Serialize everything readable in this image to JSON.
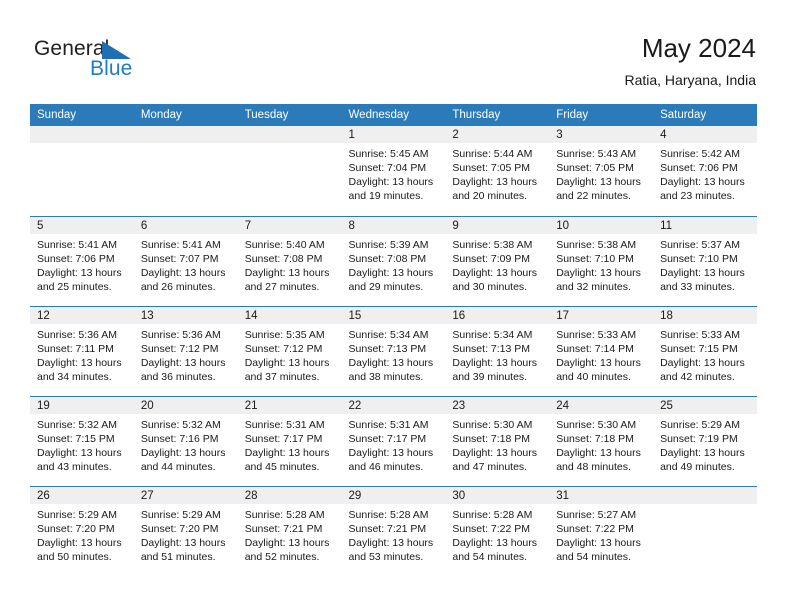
{
  "brand": {
    "name_part1": "General",
    "name_part2": "Blue",
    "flag_icon": "triangle-flag-icon",
    "accent_color": "#1f7ac7"
  },
  "header": {
    "month_title": "May 2024",
    "location": "Ratia, Haryana, India"
  },
  "colors": {
    "header_blue": "#2b7bba",
    "daynum_band": "#efefef",
    "text": "#1a1a1a"
  },
  "calendar": {
    "weekday_headers": [
      "Sunday",
      "Monday",
      "Tuesday",
      "Wednesday",
      "Thursday",
      "Friday",
      "Saturday"
    ],
    "weeks": [
      [
        {
          "day": "",
          "lines": []
        },
        {
          "day": "",
          "lines": []
        },
        {
          "day": "",
          "lines": []
        },
        {
          "day": "1",
          "lines": [
            "Sunrise: 5:45 AM",
            "Sunset: 7:04 PM",
            "Daylight: 13 hours",
            "and 19 minutes."
          ]
        },
        {
          "day": "2",
          "lines": [
            "Sunrise: 5:44 AM",
            "Sunset: 7:05 PM",
            "Daylight: 13 hours",
            "and 20 minutes."
          ]
        },
        {
          "day": "3",
          "lines": [
            "Sunrise: 5:43 AM",
            "Sunset: 7:05 PM",
            "Daylight: 13 hours",
            "and 22 minutes."
          ]
        },
        {
          "day": "4",
          "lines": [
            "Sunrise: 5:42 AM",
            "Sunset: 7:06 PM",
            "Daylight: 13 hours",
            "and 23 minutes."
          ]
        }
      ],
      [
        {
          "day": "5",
          "lines": [
            "Sunrise: 5:41 AM",
            "Sunset: 7:06 PM",
            "Daylight: 13 hours",
            "and 25 minutes."
          ]
        },
        {
          "day": "6",
          "lines": [
            "Sunrise: 5:41 AM",
            "Sunset: 7:07 PM",
            "Daylight: 13 hours",
            "and 26 minutes."
          ]
        },
        {
          "day": "7",
          "lines": [
            "Sunrise: 5:40 AM",
            "Sunset: 7:08 PM",
            "Daylight: 13 hours",
            "and 27 minutes."
          ]
        },
        {
          "day": "8",
          "lines": [
            "Sunrise: 5:39 AM",
            "Sunset: 7:08 PM",
            "Daylight: 13 hours",
            "and 29 minutes."
          ]
        },
        {
          "day": "9",
          "lines": [
            "Sunrise: 5:38 AM",
            "Sunset: 7:09 PM",
            "Daylight: 13 hours",
            "and 30 minutes."
          ]
        },
        {
          "day": "10",
          "lines": [
            "Sunrise: 5:38 AM",
            "Sunset: 7:10 PM",
            "Daylight: 13 hours",
            "and 32 minutes."
          ]
        },
        {
          "day": "11",
          "lines": [
            "Sunrise: 5:37 AM",
            "Sunset: 7:10 PM",
            "Daylight: 13 hours",
            "and 33 minutes."
          ]
        }
      ],
      [
        {
          "day": "12",
          "lines": [
            "Sunrise: 5:36 AM",
            "Sunset: 7:11 PM",
            "Daylight: 13 hours",
            "and 34 minutes."
          ]
        },
        {
          "day": "13",
          "lines": [
            "Sunrise: 5:36 AM",
            "Sunset: 7:12 PM",
            "Daylight: 13 hours",
            "and 36 minutes."
          ]
        },
        {
          "day": "14",
          "lines": [
            "Sunrise: 5:35 AM",
            "Sunset: 7:12 PM",
            "Daylight: 13 hours",
            "and 37 minutes."
          ]
        },
        {
          "day": "15",
          "lines": [
            "Sunrise: 5:34 AM",
            "Sunset: 7:13 PM",
            "Daylight: 13 hours",
            "and 38 minutes."
          ]
        },
        {
          "day": "16",
          "lines": [
            "Sunrise: 5:34 AM",
            "Sunset: 7:13 PM",
            "Daylight: 13 hours",
            "and 39 minutes."
          ]
        },
        {
          "day": "17",
          "lines": [
            "Sunrise: 5:33 AM",
            "Sunset: 7:14 PM",
            "Daylight: 13 hours",
            "and 40 minutes."
          ]
        },
        {
          "day": "18",
          "lines": [
            "Sunrise: 5:33 AM",
            "Sunset: 7:15 PM",
            "Daylight: 13 hours",
            "and 42 minutes."
          ]
        }
      ],
      [
        {
          "day": "19",
          "lines": [
            "Sunrise: 5:32 AM",
            "Sunset: 7:15 PM",
            "Daylight: 13 hours",
            "and 43 minutes."
          ]
        },
        {
          "day": "20",
          "lines": [
            "Sunrise: 5:32 AM",
            "Sunset: 7:16 PM",
            "Daylight: 13 hours",
            "and 44 minutes."
          ]
        },
        {
          "day": "21",
          "lines": [
            "Sunrise: 5:31 AM",
            "Sunset: 7:17 PM",
            "Daylight: 13 hours",
            "and 45 minutes."
          ]
        },
        {
          "day": "22",
          "lines": [
            "Sunrise: 5:31 AM",
            "Sunset: 7:17 PM",
            "Daylight: 13 hours",
            "and 46 minutes."
          ]
        },
        {
          "day": "23",
          "lines": [
            "Sunrise: 5:30 AM",
            "Sunset: 7:18 PM",
            "Daylight: 13 hours",
            "and 47 minutes."
          ]
        },
        {
          "day": "24",
          "lines": [
            "Sunrise: 5:30 AM",
            "Sunset: 7:18 PM",
            "Daylight: 13 hours",
            "and 48 minutes."
          ]
        },
        {
          "day": "25",
          "lines": [
            "Sunrise: 5:29 AM",
            "Sunset: 7:19 PM",
            "Daylight: 13 hours",
            "and 49 minutes."
          ]
        }
      ],
      [
        {
          "day": "26",
          "lines": [
            "Sunrise: 5:29 AM",
            "Sunset: 7:20 PM",
            "Daylight: 13 hours",
            "and 50 minutes."
          ]
        },
        {
          "day": "27",
          "lines": [
            "Sunrise: 5:29 AM",
            "Sunset: 7:20 PM",
            "Daylight: 13 hours",
            "and 51 minutes."
          ]
        },
        {
          "day": "28",
          "lines": [
            "Sunrise: 5:28 AM",
            "Sunset: 7:21 PM",
            "Daylight: 13 hours",
            "and 52 minutes."
          ]
        },
        {
          "day": "29",
          "lines": [
            "Sunrise: 5:28 AM",
            "Sunset: 7:21 PM",
            "Daylight: 13 hours",
            "and 53 minutes."
          ]
        },
        {
          "day": "30",
          "lines": [
            "Sunrise: 5:28 AM",
            "Sunset: 7:22 PM",
            "Daylight: 13 hours",
            "and 54 minutes."
          ]
        },
        {
          "day": "31",
          "lines": [
            "Sunrise: 5:27 AM",
            "Sunset: 7:22 PM",
            "Daylight: 13 hours",
            "and 54 minutes."
          ]
        },
        {
          "day": "",
          "lines": []
        }
      ]
    ]
  }
}
